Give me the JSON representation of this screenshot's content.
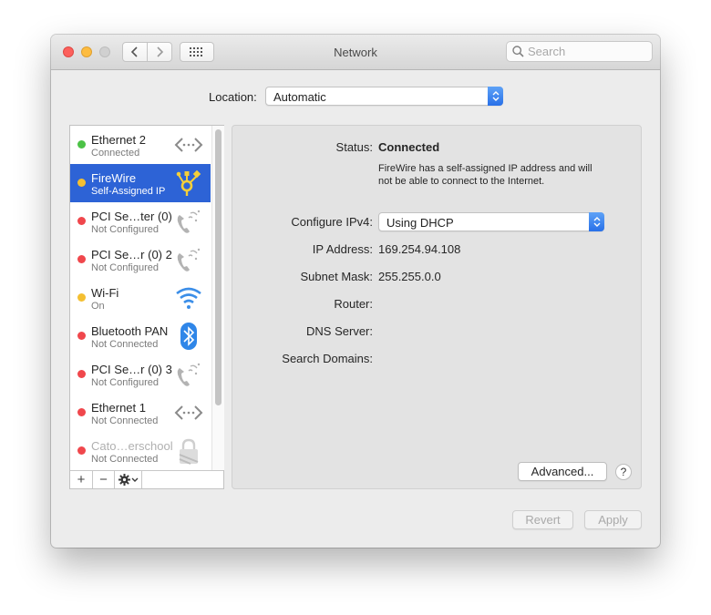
{
  "window": {
    "title": "Network"
  },
  "search": {
    "placeholder": "Search"
  },
  "location": {
    "label": "Location:",
    "value": "Automatic"
  },
  "services": [
    {
      "name": "Ethernet 2",
      "status": "Connected",
      "dot": "#4cc246",
      "icon": "ethernet-icon"
    },
    {
      "name": "FireWire",
      "status": "Self-Assigned IP",
      "dot": "#f4bf31",
      "icon": "firewire-icon"
    },
    {
      "name": "PCI Se…ter (0)",
      "status": "Not Configured",
      "dot": "#f0474c",
      "icon": "phone-icon"
    },
    {
      "name": "PCI Se…r (0) 2",
      "status": "Not Configured",
      "dot": "#f0474c",
      "icon": "phone-icon"
    },
    {
      "name": "Wi-Fi",
      "status": "On",
      "dot": "#f4bf31",
      "icon": "wifi-icon"
    },
    {
      "name": "Bluetooth PAN",
      "status": "Not Connected",
      "dot": "#f0474c",
      "icon": "bluetooth-icon"
    },
    {
      "name": "PCI Se…r (0) 3",
      "status": "Not Configured",
      "dot": "#f0474c",
      "icon": "phone-icon"
    },
    {
      "name": "Ethernet 1",
      "status": "Not Connected",
      "dot": "#f0474c",
      "icon": "ethernet-icon"
    },
    {
      "name": "Cato…erschool",
      "status": "Not Connected",
      "dot": "#f0474c",
      "icon": "vpn-lock-icon"
    }
  ],
  "sidebar_toolbar": {
    "add": "+",
    "remove": "−"
  },
  "detail": {
    "status_label": "Status:",
    "status_value": "Connected",
    "status_description": "FireWire has a self-assigned IP address and will not be able to connect to the Internet.",
    "configure_label": "Configure IPv4:",
    "configure_value": "Using DHCP",
    "ip_label": "IP Address:",
    "ip_value": "169.254.94.108",
    "subnet_label": "Subnet Mask:",
    "subnet_value": "255.255.0.0",
    "router_label": "Router:",
    "dns_label": "DNS Server:",
    "search_domains_label": "Search Domains:"
  },
  "buttons": {
    "advanced": "Advanced...",
    "help": "?",
    "revert": "Revert",
    "apply": "Apply"
  },
  "colors": {
    "selection": "#2d63d6",
    "accent": "#2870e8"
  }
}
